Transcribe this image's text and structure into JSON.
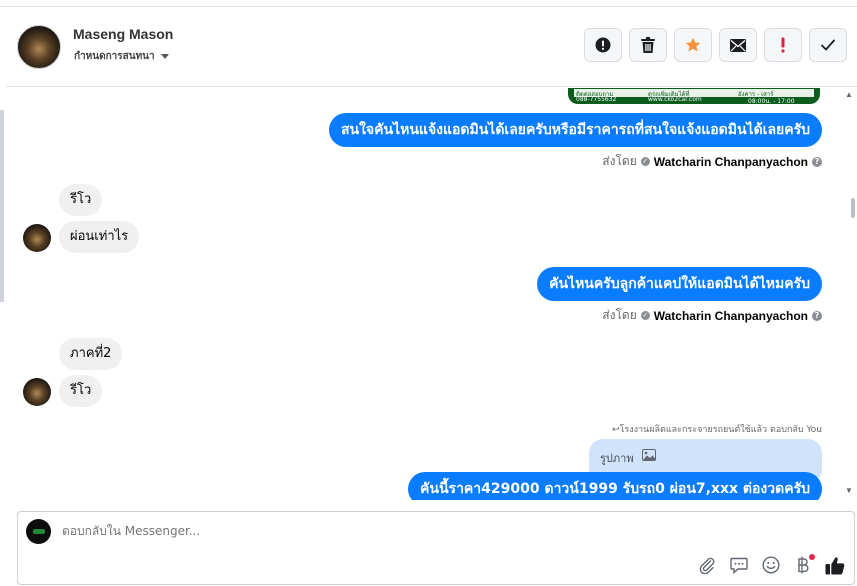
{
  "header": {
    "contact_name": "Maseng Mason",
    "assign_label": "กำหนดการสนทนา",
    "actions": [
      {
        "name": "mark-spam-button",
        "icon": "alert-circle-icon",
        "color": "#1c1e21"
      },
      {
        "name": "delete-button",
        "icon": "trash-icon",
        "color": "#1c1e21"
      },
      {
        "name": "star-button",
        "icon": "star-icon",
        "color": "#f7923b"
      },
      {
        "name": "mark-unread-button",
        "icon": "envelope-icon",
        "color": "#1c1e21"
      },
      {
        "name": "follow-up-button",
        "icon": "exclamation-icon",
        "color": "#e41e3f"
      },
      {
        "name": "done-button",
        "icon": "check-icon",
        "color": "#1c1e21"
      }
    ]
  },
  "image_strip": {
    "left_text": "ติดต่อสอบถาม",
    "left_phone": "088-7755632",
    "mid_text": "ดูรถเพิ่มเติมได้ที่",
    "mid_url": "www.cko2car.com",
    "right_text": "อังคาร - เสาร์",
    "right_time": "08:00น. - 17:00"
  },
  "messages": {
    "out1": "สนใจคันไหนแจ้งแอดมินได้เลยครับหรือมีราคารถที่สนใจแจ้งแอดมินได้เลยครับ",
    "sent_by_label": "ส่งโดย",
    "sent_by_name": "Watcharin Chanpanyachon",
    "in1": "รีโว",
    "in2": "ผ่อนเท่าไร",
    "out2": "คันไหนครับลูกค้าแคปให้แอดมินได้ไหมครับ",
    "in3": "ภาคที่2",
    "in4": "รีโว",
    "reply_note": "↩โรงงานผลิตและกระจายรถยนต์ใช้แล้ว ตอบกลับ You",
    "reply_quote": "รูปภาพ",
    "out3": "คันนี้ราคา429000 ดาวน์1999 รับรถ0 ผ่อน7,xxx ต่องวดครับ"
  },
  "composer": {
    "placeholder": "ตอบกลับใน Messenger..."
  }
}
